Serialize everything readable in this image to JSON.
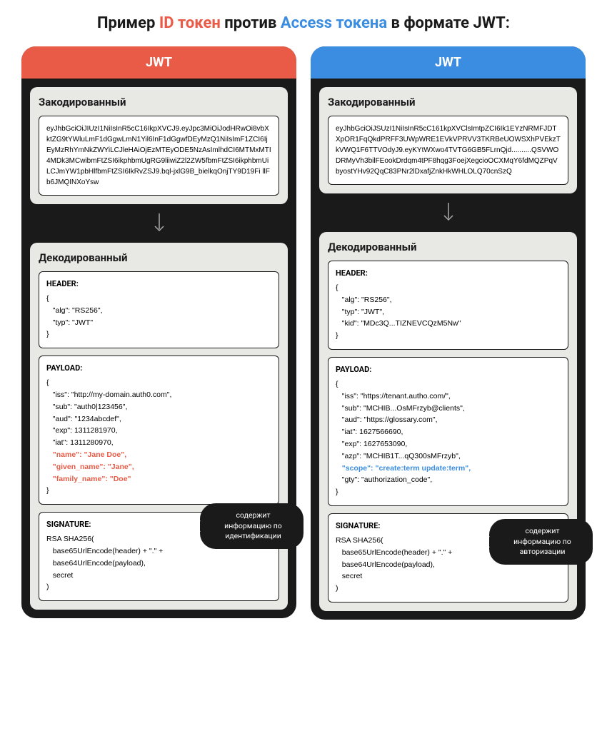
{
  "title": {
    "prefix": "Пример ",
    "id": "ID токен",
    "mid": " против ",
    "access": "Access токена",
    "suffix": " в формате JWT:"
  },
  "left": {
    "header": "JWT",
    "encoded_label": "Закодированный",
    "encoded": "eyJhbGciOiJIUzI1NiIsInR5cC16IkpXVCJ9.eyJpc3MiOiJodHRwOi8vbXktZG9tYWluLmF1dGgwLmN1Yil6InF1dGgwfDEyMzQ1NiIsImF1ZCI6IjEyMzRhYmNkZWYiLCJleHAiOjEzMTEyODE5NzAsImlhdCI6MTMxMTI4MDk3MCwibmFtZSI6ikphbmUgRG9liiwiZ2l2ZW5fbmFtZSI6ikphbmUiLCJmYW1pbHlfbmFtZSI6IkRvZSJ9.bql-jxlG9B_bielkqOnjTY9D19Fi llFb6JMQINXoYsw",
    "decoded_label": "Декодированный",
    "header_label": "HEADER:",
    "header_code": "{\n   \"alg\": \"RS256\",\n   \"typ\": \"JWT\"\n}",
    "payload_label": "PAYLOAD:",
    "payload_prefix": "{\n   \"iss\": \"http://my-domain.auth0.com\",\n   \"sub\": \"auth0|123456\",\n   \"aud\": \"1234abcdef\",\n   \"exp\": 1311281970,\n   \"iat\": 1311280970,",
    "payload_hl": "   \"name\": \"Jane Doe\",\n   \"given_name\": \"Jane\",\n   \"family_name\": \"Doe\"",
    "payload_suffix": "}",
    "sig_label": "SIGNATURE:",
    "sig_code": "RSA SHA256(\n   base65UrlEncode(header) + \".\" +\n   base64UrlEncode(payload),\n   secret\n)",
    "tooltip": "содержит информацию по идентификации"
  },
  "right": {
    "header": "JWT",
    "encoded_label": "Закодированный",
    "encoded": "eyJhbGciOiJSUzI1NiIsInR5cC161kpXVClsImtpZCI6Ik1EYzNRMFJDTXpOR1FqQkdPRFF3UWpWRE1EVkVPRVV3TKRBeUOWSXhPVEkzTkVWQ1F6TTVOdyJ9.eyKYtWXwo4TVTG6GB5FLrnQjd..........QSVWODRMyVh3bilFEookDrdqm4tPF8hqg3FoejXegcioOCXMqY6fdMQZPqVbyostYHv92QqC83PNr2lDxafjZnkHkWHLOLQ70cnSzQ",
    "decoded_label": "Декодированный",
    "header_label": "HEADER:",
    "header_code": "{\n   \"alg\": \"RS256\",\n   \"typ\": \"JWT\",\n   \"kid\": \"MDc3Q...TIZNEVCQzM5Nw\"\n}",
    "payload_label": "PAYLOAD:",
    "payload_prefix": "{\n   \"iss\": \"https://tenant.autho.com/\",\n   \"sub\": \"MCHIB...OsMFrzyb@clients\",\n   \"aud\": \"https://glossary.com\",\n   \"iat\": 1627566690,\n   \"exp\": 1627653090,\n   \"azp\": \"MCHIB1T...qQ300sMFrzyb\",",
    "payload_hl": "   \"scope\": \"create:term update:term\",",
    "payload_suffix": "   \"gty\": \"authorization_code\",\n}",
    "sig_label": "SIGNATURE:",
    "sig_code": "RSA SHA256(\n   base65UrlEncode(header) + \".\" +\n   base64UrlEncode(payload),\n   secret\n)",
    "tooltip": "содержит информацию по авторизации"
  }
}
